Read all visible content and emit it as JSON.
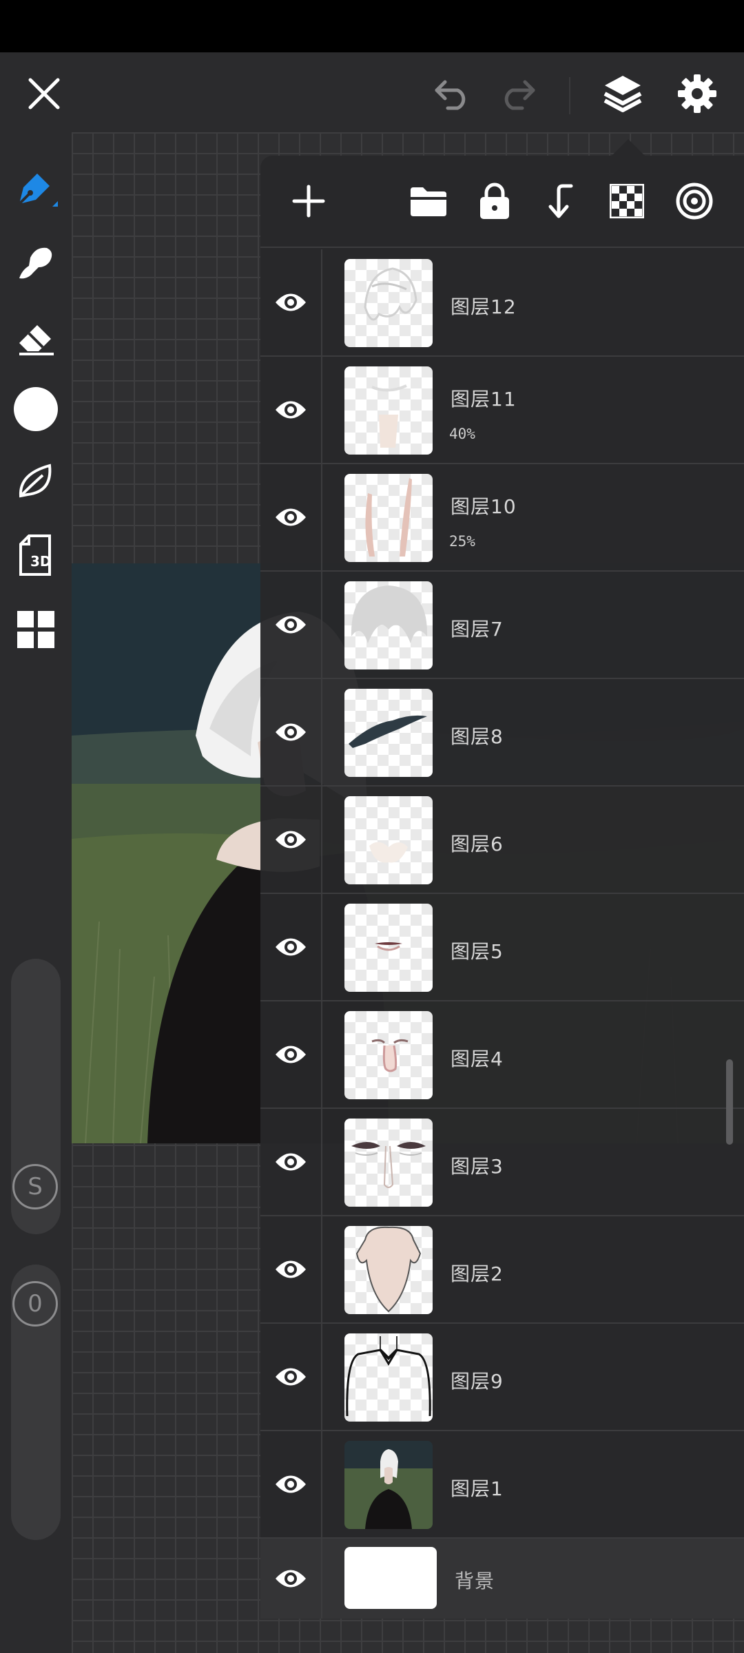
{
  "colors": {
    "accent": "#1e88e5",
    "toolbar_bg": "#2b2b2d",
    "panel_bg": "#28282a",
    "icon_light": "#ffffff",
    "icon_dim": "#7a7a7c"
  },
  "topbar": {
    "icons": [
      "close-icon",
      "undo-icon",
      "redo-icon",
      "layers-icon",
      "settings-icon"
    ]
  },
  "leftbar": {
    "tools": [
      "pen-tool-icon",
      "smudge-tool-icon",
      "eraser-icon",
      "color-swatch",
      "leaf-brush-icon",
      "3d-icon",
      "grid-apps-icon"
    ],
    "size_slider_label": "S",
    "opacity_slider_label": "0"
  },
  "layers_panel": {
    "toolbar_icons": [
      "add-layer-icon",
      "folder-icon",
      "lock-icon",
      "merge-down-icon",
      "transparency-icon",
      "blend-mode-icon"
    ],
    "layers": [
      {
        "name": "图层12",
        "opacity": "",
        "visible": true,
        "thumb": "hair-sketch"
      },
      {
        "name": "图层11",
        "opacity": "40%",
        "visible": true,
        "thumb": "neck-light"
      },
      {
        "name": "图层10",
        "opacity": "25%",
        "visible": true,
        "thumb": "neck-shadow"
      },
      {
        "name": "图层7",
        "opacity": "",
        "visible": true,
        "thumb": "hair-grey"
      },
      {
        "name": "图层8",
        "opacity": "",
        "visible": true,
        "thumb": "brush-stroke"
      },
      {
        "name": "图层6",
        "opacity": "",
        "visible": true,
        "thumb": "faint-blob"
      },
      {
        "name": "图层5",
        "opacity": "",
        "visible": true,
        "thumb": "lips"
      },
      {
        "name": "图层4",
        "opacity": "",
        "visible": true,
        "thumb": "nose"
      },
      {
        "name": "图层3",
        "opacity": "",
        "visible": true,
        "thumb": "eyes"
      },
      {
        "name": "图层2",
        "opacity": "",
        "visible": true,
        "thumb": "face-skin"
      },
      {
        "name": "图层9",
        "opacity": "",
        "visible": true,
        "thumb": "shirt-lines"
      },
      {
        "name": "图层1",
        "opacity": "",
        "visible": true,
        "thumb": "full-painting"
      }
    ],
    "background_layer": {
      "name": "背景",
      "visible": true
    }
  }
}
